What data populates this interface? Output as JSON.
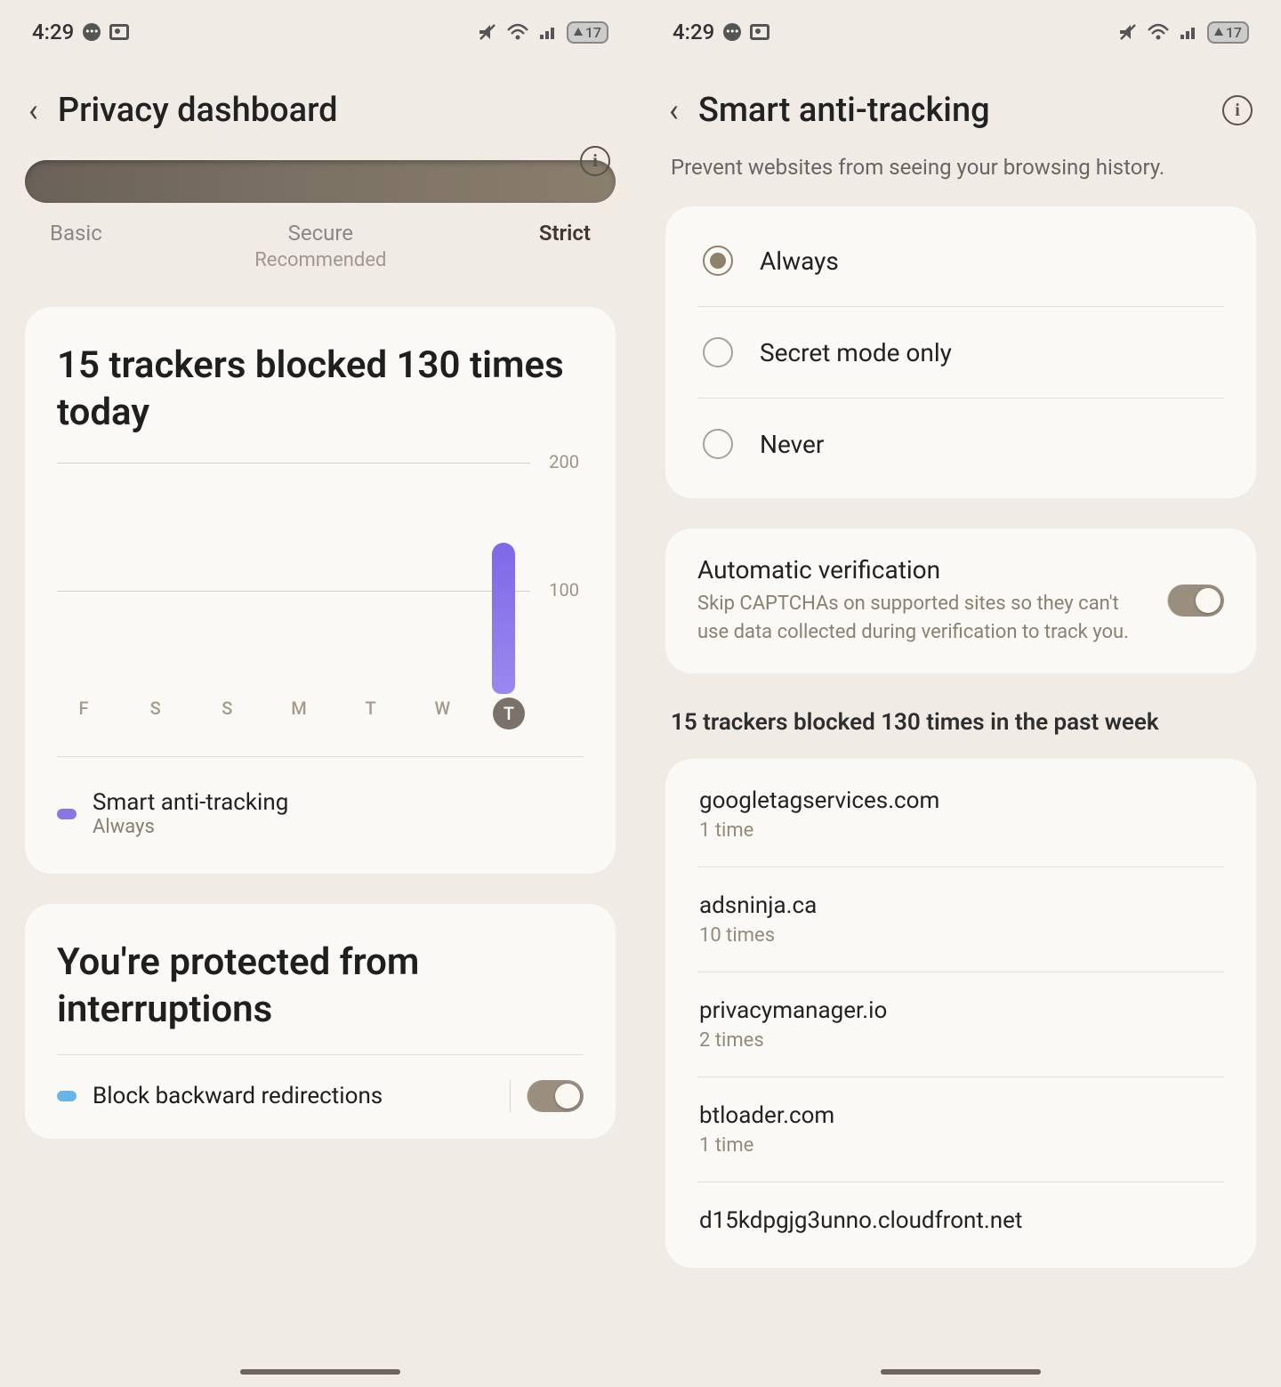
{
  "status": {
    "time": "4:29",
    "battery": "17"
  },
  "left": {
    "title": "Privacy dashboard",
    "levels": {
      "basic": "Basic",
      "secure": "Secure",
      "recommended": "Recommended",
      "strict": "Strict"
    },
    "trackers_headline": "15 trackers blocked 130 times today",
    "smart_anti_tracking": {
      "name": "Smart anti-tracking",
      "value": "Always"
    },
    "protected_headline": "You're protected from interruptions",
    "block_backward": "Block backward redirections"
  },
  "right": {
    "title": "Smart anti-tracking",
    "subtitle": "Prevent websites from seeing your browsing history.",
    "options": {
      "always": "Always",
      "secret": "Secret mode only",
      "never": "Never"
    },
    "auto_verify": {
      "title": "Automatic verification",
      "desc": "Skip CAPTCHAs on supported sites so they can't use data collected during verification to track you."
    },
    "trackers_header": "15 trackers blocked 130 times in the past week",
    "trackers": [
      {
        "domain": "googletagservices.com",
        "count": "1 time"
      },
      {
        "domain": "adsninja.ca",
        "count": "10 times"
      },
      {
        "domain": "privacymanager.io",
        "count": "2 times"
      },
      {
        "domain": "btloader.com",
        "count": "1 time"
      },
      {
        "domain": "d15kdpgjg3unno.cloudfront.net",
        "count": ""
      }
    ]
  },
  "chart_data": {
    "type": "bar",
    "categories": [
      "F",
      "S",
      "S",
      "M",
      "T",
      "W",
      "T"
    ],
    "values": [
      0,
      0,
      0,
      0,
      0,
      0,
      130
    ],
    "ylim": [
      0,
      200
    ],
    "grid_ticks": [
      100,
      200
    ],
    "ylabel": "",
    "title": ""
  }
}
